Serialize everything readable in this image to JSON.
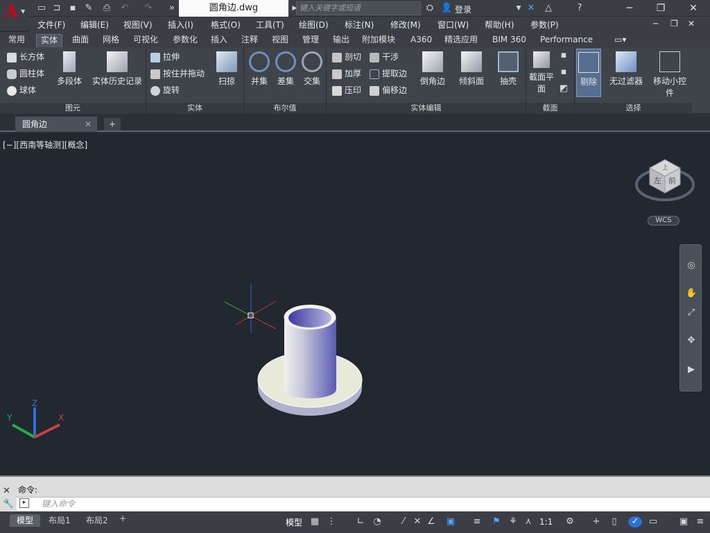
{
  "app": {
    "logo": "A"
  },
  "title": {
    "document": "圆角边.dwg",
    "search_placeholder": "键入关键字或短语",
    "login": "登录"
  },
  "menu": [
    "文件(F)",
    "编辑(E)",
    "视图(V)",
    "插入(I)",
    "格式(O)",
    "工具(T)",
    "绘图(D)",
    "标注(N)",
    "修改(M)",
    "窗口(W)",
    "帮助(H)",
    "参数(P)"
  ],
  "ribbon_tabs": [
    "常用",
    "实体",
    "曲面",
    "网格",
    "可视化",
    "参数化",
    "插入",
    "注释",
    "视图",
    "管理",
    "输出",
    "附加模块",
    "A360",
    "精选应用",
    "BIM 360",
    "Performance"
  ],
  "ribbon_active_tab": "实体",
  "panels": {
    "primitive": {
      "title": "图元",
      "box": "长方体",
      "cylinder": "圆柱体",
      "sphere": "球体",
      "polysolid": "多段体",
      "history": "实体历史记录"
    },
    "solid": {
      "title": "实体",
      "extrude": "拉伸",
      "presspull": "按住并拖动",
      "revolve": "旋转",
      "sweep": "扫掠"
    },
    "boolean": {
      "title": "布尔值",
      "union": "并集",
      "subtract": "差集",
      "intersect": "交集"
    },
    "solidedit": {
      "title": "实体编辑",
      "slice": "剖切",
      "interfere": "干涉",
      "thicken": "加厚",
      "extract_edges": "提取边",
      "imprint": "压印",
      "offset_edges": "偏移边",
      "fillet_edge": "倒角边",
      "taper": "倾斜面",
      "shell": "抽壳"
    },
    "section": {
      "title": "截面",
      "plane": "截面平面"
    },
    "selection": {
      "title": "选择",
      "culling": "剔除",
      "no_filter": "无过滤器",
      "gizmo": "移动小控件"
    }
  },
  "file_tab": {
    "name": "圆角边"
  },
  "viewport": {
    "label": "[−][西南等轴测][概念]",
    "wcs": "WCS",
    "cube_top": "上",
    "cube_front": "前",
    "cube_left": "左"
  },
  "command": {
    "history": "命令:",
    "placeholder": "键入命令"
  },
  "layouts": [
    "模型",
    "布局1",
    "布局2"
  ],
  "status": {
    "model": "模型",
    "scale": "1:1"
  },
  "colors": {
    "accent": "#d0021b",
    "viewport_bg": "#212830",
    "ribbon_bg": "#3f444b"
  }
}
